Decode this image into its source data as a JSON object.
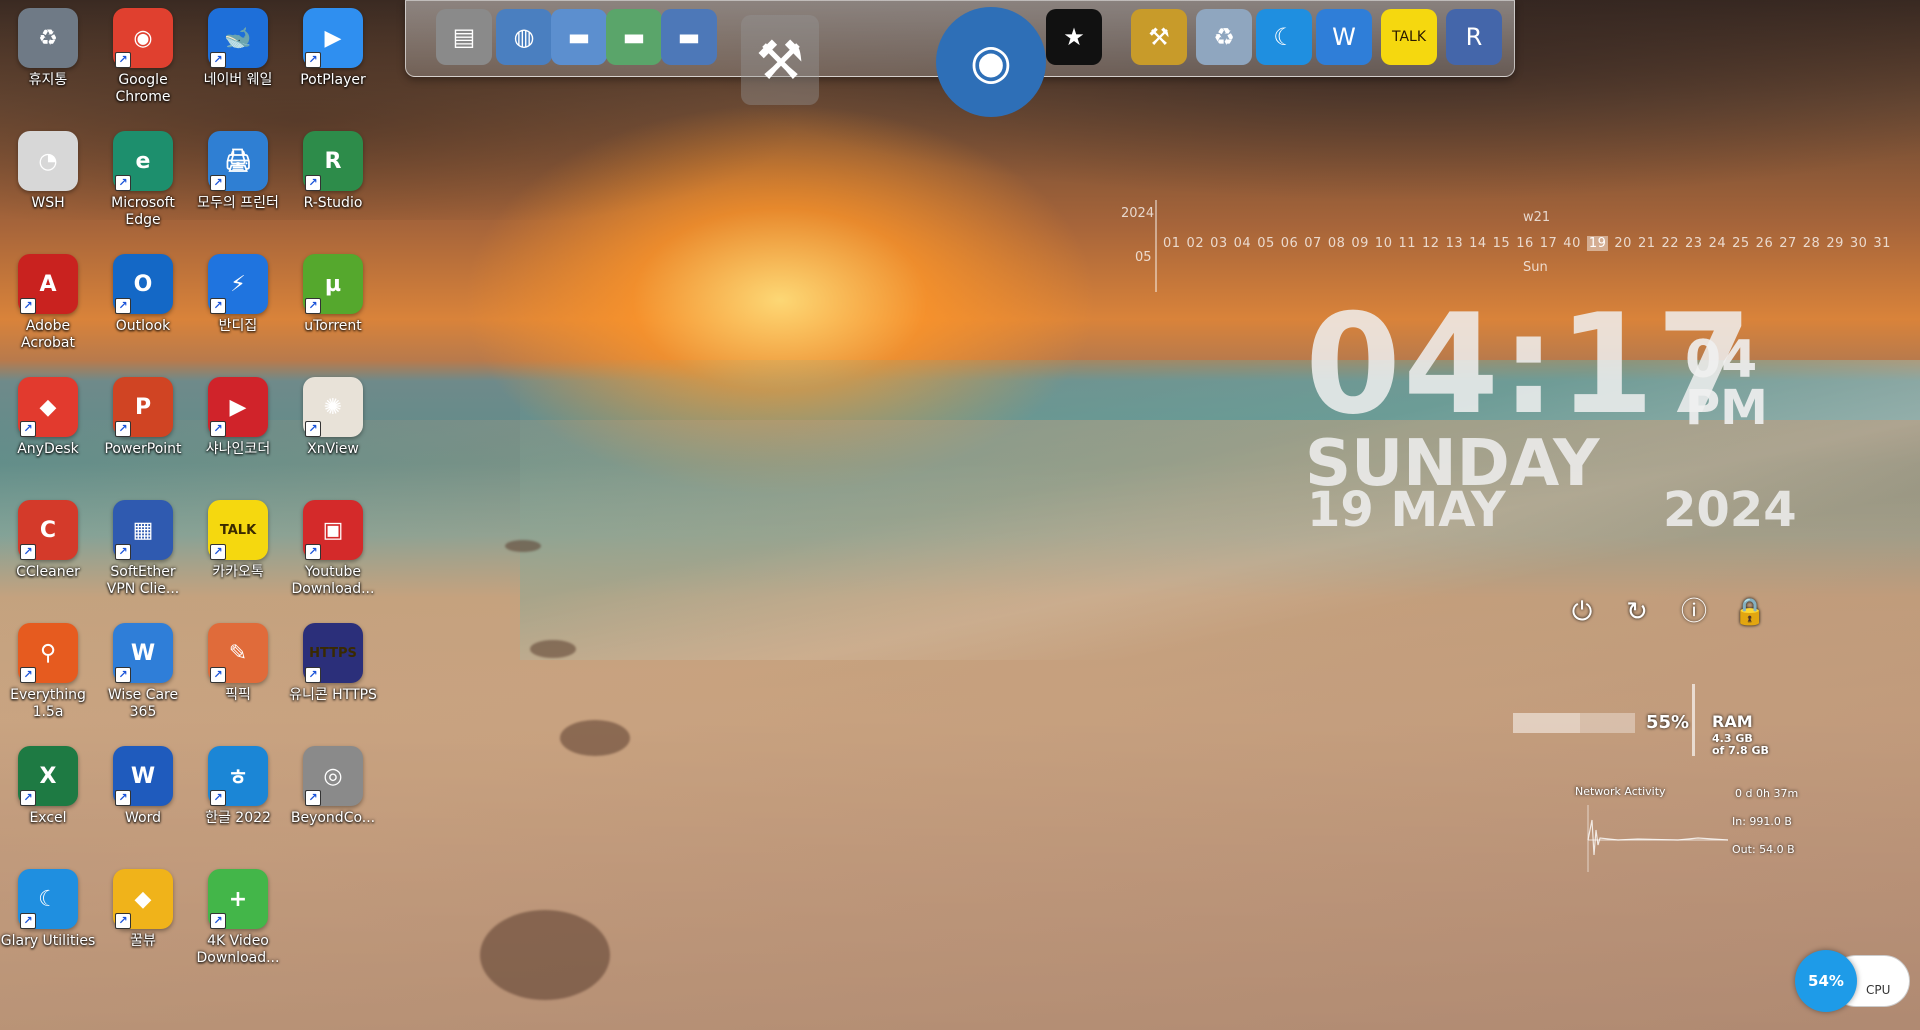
{
  "desktop_icons": [
    {
      "name": "휴지통",
      "color": "#6f7a86",
      "glyph": "♻"
    },
    {
      "name": "Google Chrome",
      "color": "#e0402f",
      "glyph": "◉"
    },
    {
      "name": "네이버 웨일",
      "color": "#1e6fd9",
      "glyph": "🐋"
    },
    {
      "name": "PotPlayer",
      "color": "#2f8ff0",
      "glyph": "▶"
    },
    {
      "name": "WSH",
      "color": "#d7d7d7",
      "glyph": "◔"
    },
    {
      "name": "Microsoft Edge",
      "color": "#1d8f6d",
      "glyph": "e"
    },
    {
      "name": "모두의 프린터",
      "color": "#2f7fd3",
      "glyph": "🖨"
    },
    {
      "name": "R-Studio",
      "color": "#2d8c4a",
      "glyph": "R"
    },
    {
      "name": "Adobe Acrobat",
      "color": "#c9221f",
      "glyph": "A"
    },
    {
      "name": "Outlook",
      "color": "#1468c6",
      "glyph": "O"
    },
    {
      "name": "반디집",
      "color": "#1f74df",
      "glyph": "⚡"
    },
    {
      "name": "uTorrent",
      "color": "#55a82d",
      "glyph": "µ"
    },
    {
      "name": "AnyDesk",
      "color": "#e23a2e",
      "glyph": "◆"
    },
    {
      "name": "PowerPoint",
      "color": "#d04423",
      "glyph": "P"
    },
    {
      "name": "샤나인코더",
      "color": "#d0232a",
      "glyph": "▶"
    },
    {
      "name": "XnView",
      "color": "#e8e2d8",
      "glyph": "✺"
    },
    {
      "name": "CCleaner",
      "color": "#d43a2a",
      "glyph": "C"
    },
    {
      "name": "SoftEther VPN Clie...",
      "color": "#2f5ab0",
      "glyph": "▦"
    },
    {
      "name": "카카오톡",
      "color": "#f5d80f",
      "glyph": "TALK"
    },
    {
      "name": "Youtube Download...",
      "color": "#d42a2a",
      "glyph": "▣"
    },
    {
      "name": "Everything 1.5a",
      "color": "#e65b1f",
      "glyph": "⚲"
    },
    {
      "name": "Wise Care 365",
      "color": "#2f7ed8",
      "glyph": "W"
    },
    {
      "name": "픽픽",
      "color": "#e06b3a",
      "glyph": "✎"
    },
    {
      "name": "유니콘 HTTPS",
      "color": "#2b2f7a",
      "glyph": "HTTPS"
    },
    {
      "name": "Excel",
      "color": "#1e7a43",
      "glyph": "X"
    },
    {
      "name": "Word",
      "color": "#1f5bbd",
      "glyph": "W"
    },
    {
      "name": "한글 2022",
      "color": "#1b86d6",
      "glyph": "ㅎ"
    },
    {
      "name": "BeyondCo...",
      "color": "#8a8a8a",
      "glyph": "◎"
    },
    {
      "name": "Glary Utilities",
      "color": "#1f8fe0",
      "glyph": "☾"
    },
    {
      "name": "꿀뷰",
      "color": "#f0b31a",
      "glyph": "◆"
    },
    {
      "name": "4K Video Download...",
      "color": "#43b649",
      "glyph": "+"
    }
  ],
  "dock_items": [
    {
      "name": "document",
      "color": "#8a8a8a",
      "glyph": "▤"
    },
    {
      "name": "globe",
      "color": "#4a7fc0",
      "glyph": "◍"
    },
    {
      "name": "folder",
      "color": "#5c8fcf",
      "glyph": "▬"
    },
    {
      "name": "folder-green",
      "color": "#5aa56a",
      "glyph": "▬"
    },
    {
      "name": "folder-blue",
      "color": "#4d78b8",
      "glyph": "▬"
    },
    {
      "name": "tools",
      "color": "#9a9a9a",
      "glyph": "⚒"
    },
    {
      "name": "earth",
      "color": "#2e6fb7",
      "glyph": "◉"
    },
    {
      "name": "shirt",
      "color": "#111111",
      "glyph": "★"
    },
    {
      "name": "hammer",
      "color": "#c89b2a",
      "glyph": "⚒"
    },
    {
      "name": "recycle",
      "color": "#8fa6bf",
      "glyph": "♻"
    },
    {
      "name": "glary",
      "color": "#1f8fe0",
      "glyph": "☾"
    },
    {
      "name": "wise",
      "color": "#2f7ed8",
      "glyph": "W"
    },
    {
      "name": "kakao",
      "color": "#f5d80f",
      "glyph": "TALK"
    },
    {
      "name": "registry",
      "color": "#4466aa",
      "glyph": "R"
    }
  ],
  "calendar": {
    "year": "2024",
    "month": "05",
    "week": "w21",
    "dow": "Sun",
    "days": [
      "01",
      "02",
      "03",
      "04",
      "05",
      "06",
      "07",
      "08",
      "09",
      "10",
      "11",
      "12",
      "13",
      "14",
      "15",
      "16",
      "17",
      "40",
      "19",
      "20",
      "21",
      "22",
      "23",
      "24",
      "25",
      "26",
      "27",
      "28",
      "29",
      "30",
      "31"
    ],
    "today": "19"
  },
  "clock": {
    "time": "04:17",
    "seconds": "04",
    "ampm": "PM",
    "day": "SUNDAY",
    "date": "19 MAY",
    "year": "2024"
  },
  "power": {
    "shutdown": "⏻",
    "restart": "↻",
    "info": "ⓘ",
    "lock": "🔒"
  },
  "ram": {
    "percent_text": "55%",
    "title": "RAM",
    "used": "4.3 GB",
    "total": "of 7.8 GB",
    "percent": 55
  },
  "network": {
    "title": "Network Activity",
    "uptime": "0 d 0h 37m",
    "in": "In: 991.0 B",
    "out": "Out: 54.0 B"
  },
  "cpu": {
    "percent_text": "54%",
    "label": "CPU"
  }
}
